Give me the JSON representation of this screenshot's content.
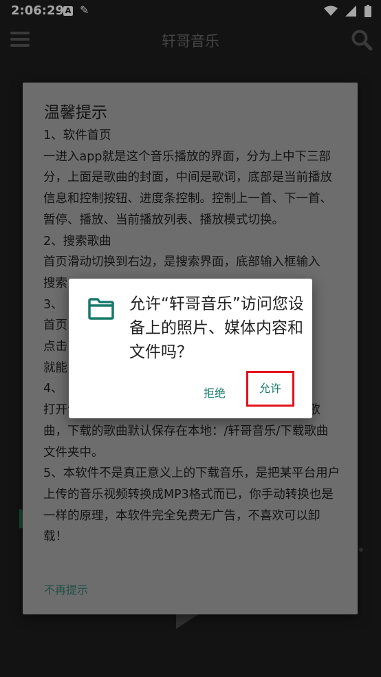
{
  "status_bar": {
    "time": "2:06:29",
    "icons": [
      "a-notification-icon",
      "edit-icon",
      "wifi-icon",
      "signal-icon",
      "battery-icon"
    ]
  },
  "app_bar": {
    "title": "轩哥音乐",
    "icons": [
      "menu-icon",
      "search-icon"
    ]
  },
  "tips_dialog": {
    "title": "温馨提示",
    "paragraphs": [
      "1、软件首页",
      "一进入app就是这个音乐播放的界面，分为上中下三部分，上面是歌曲的封面，中间是歌词，底部是当前播放信息和控制按钮、进度条控制。控制上一首、下一首、暂停、播放、当前播放列表、播放模式切换。",
      "2、搜索歌曲",
      "首页滑动切换到右边，是搜索界面，底部输入框输入",
      "搜索",
      "3、",
      "首页",
      "点击",
      "就能",
      "4、",
      "打开音乐详情后，有一个下载按钮，点击即可下载歌曲，下载的歌曲默认保存在本地：/轩哥音乐/下载歌曲 文件夹中。",
      "5、本软件不是真正意义上的下载音乐，是把某平台用户上传的音乐视频转换成MP3格式而已，你手动转换也是一样的原理，本软件完全免费无广告，不喜欢可以卸载！"
    ],
    "dismiss_label": "不再提示"
  },
  "permission_dialog": {
    "message": "允许“轩哥音乐”访问您设备上的照片、媒体内容和文件吗？",
    "deny_label": "拒绝",
    "allow_label": "允许",
    "icon": "folder-icon",
    "accent_color": "#16796a",
    "highlight_color": "#e4101b"
  }
}
